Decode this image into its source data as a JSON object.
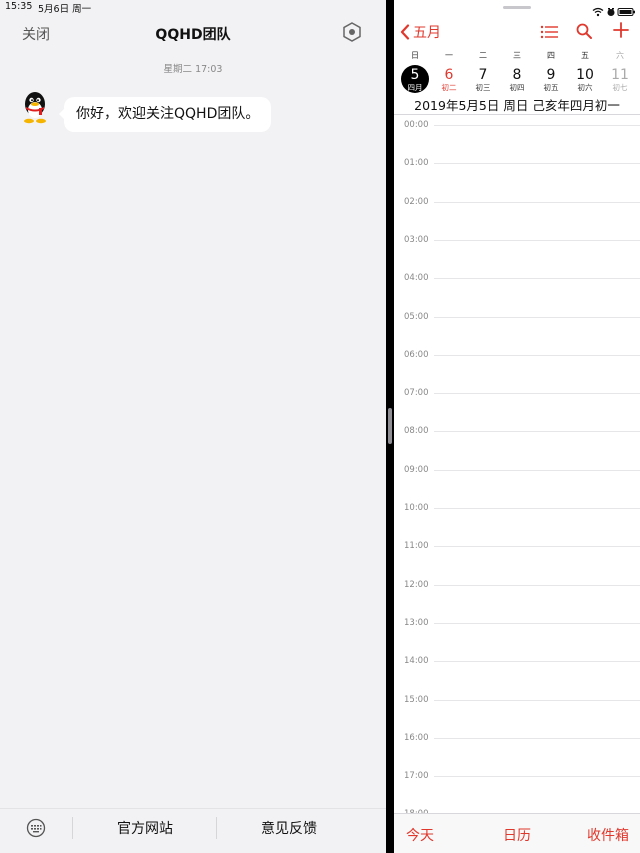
{
  "left_pane": {
    "status_bar": {
      "time": "15:35",
      "date": "5月6日 周一"
    },
    "nav": {
      "close_label": "关闭",
      "title": "QQHD团队",
      "settings_icon": "settings-hexagon-icon"
    },
    "timestamp": "星期二 17:03",
    "message": {
      "avatar_icon": "qq-penguin-icon",
      "text": "你好，欢迎关注QQHD团队。"
    },
    "bottom_bar": {
      "keyboard_icon": "keyboard-icon",
      "official_site_label": "官方网站",
      "feedback_label": "意见反馈"
    }
  },
  "right_pane": {
    "status_icons": [
      "wifi-icon",
      "alarm-icon",
      "battery-icon"
    ],
    "nav": {
      "back_label": "五月",
      "list_icon": "list-icon",
      "search_icon": "search-icon",
      "add_icon": "plus-icon"
    },
    "week": [
      {
        "weekday": "日",
        "day": "5",
        "lunar": "四月",
        "state": "selected"
      },
      {
        "weekday": "一",
        "day": "6",
        "lunar": "初二",
        "state": "red"
      },
      {
        "weekday": "二",
        "day": "7",
        "lunar": "初三",
        "state": "normal"
      },
      {
        "weekday": "三",
        "day": "8",
        "lunar": "初四",
        "state": "normal"
      },
      {
        "weekday": "四",
        "day": "9",
        "lunar": "初五",
        "state": "normal"
      },
      {
        "weekday": "五",
        "day": "10",
        "lunar": "初六",
        "state": "normal"
      },
      {
        "weekday": "六",
        "day": "11",
        "lunar": "初七",
        "state": "grey"
      }
    ],
    "date_banner": "2019年5月5日 周日  己亥年四月初一",
    "hours": [
      "00:00",
      "01:00",
      "02:00",
      "03:00",
      "04:00",
      "05:00",
      "06:00",
      "07:00",
      "08:00",
      "09:00",
      "10:00",
      "11:00",
      "12:00",
      "13:00",
      "14:00",
      "15:00",
      "16:00",
      "17:00",
      "18:00"
    ],
    "tabbar": {
      "today_label": "今天",
      "calendars_label": "日历",
      "inbox_label": "收件箱"
    },
    "accent_color": "#e0382d"
  }
}
